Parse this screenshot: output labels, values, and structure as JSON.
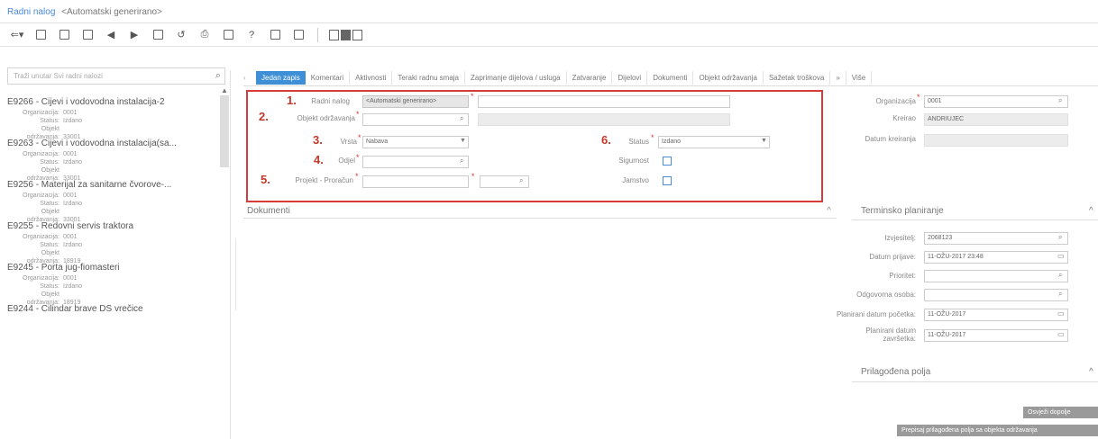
{
  "header": {
    "title": "Radni nalog",
    "subtitle": "<Automatski generirano>"
  },
  "toolbar": {
    "icons": [
      "back-dropdown-icon",
      "save-icon",
      "save-copy-icon",
      "delete-icon",
      "prev-icon",
      "next-icon",
      "copy-icon",
      "undo-icon",
      "print-icon",
      "preview-icon",
      "help-icon",
      "comment-icon",
      "attach-icon",
      "layout-icons"
    ]
  },
  "sidebar": {
    "search_placeholder": "Traži unutar Svi radni nalozi",
    "field_labels": {
      "org": "Organizacija:",
      "status": "Status:",
      "object": "Objekt održavanja:"
    },
    "items": [
      {
        "title": "E9266 - Cijevi i vodovodna instalacija-2",
        "org": "0001",
        "status": "Izdano",
        "object": "33001"
      },
      {
        "title": "E9263 - Cijevi i vodovodna instalacija(sa...",
        "org": "0001",
        "status": "Izdano",
        "object": "33001"
      },
      {
        "title": "E9256 - Materijal za sanitarne čvorove-...",
        "org": "0001",
        "status": "Izdano",
        "object": "33001"
      },
      {
        "title": "E9255 - Redovni servis traktora",
        "org": "0001",
        "status": "Izdano",
        "object": "18919"
      },
      {
        "title": "E9245 - Porta jug-fiomasteri",
        "org": "0001",
        "status": "Izdano",
        "object": "18919"
      },
      {
        "title": "E9244 - Cilindar brave DS vrečice",
        "org": "",
        "status": "",
        "object": ""
      }
    ]
  },
  "tabs": [
    "Jedan zapis",
    "Komentari",
    "Aktivnosti",
    "Teraki radnu smaja",
    "Zaprimanje dijelova / usluga",
    "Zatvaranje",
    "Dijelovi",
    "Dokumenti",
    "Objekt održavanja",
    "Sažetak troškova",
    "Više"
  ],
  "form": {
    "markers": [
      "1.",
      "2.",
      "3.",
      "4.",
      "5.",
      "6."
    ],
    "labels": {
      "radni_nalog": "Radni nalog",
      "objekt": "Objekt održavanja",
      "vrsta": "Vrsta",
      "odjel": "Odjel",
      "projekt": "Projekt - Proračun",
      "status": "Status",
      "sigurnost": "Sigurnost",
      "jamstvo": "Jamstvo"
    },
    "values": {
      "radni_nalog": "<Automatski generirano>",
      "vrsta": "Nabava",
      "status": "Izdano"
    },
    "right": {
      "organizacija_label": "Organizacija",
      "organizacija_value": "0001",
      "kreirao_label": "Kreirao",
      "kreirao_value": "ANDRIUJEC",
      "datum_kreiranja_label": "Datum kreiranja"
    }
  },
  "documents": {
    "title": "Dokumenti"
  },
  "planning": {
    "title": "Terminsko planiranje",
    "fields": [
      {
        "label": "Izvjesitelj:",
        "value": "2068123"
      },
      {
        "label": "Datum prijave:",
        "value": "11-OŽU-2017 23:48"
      },
      {
        "label": "Prioritet:",
        "value": ""
      },
      {
        "label": "Odgovorna osoba:",
        "value": ""
      },
      {
        "label": "Planirani datum početka:",
        "value": "11-OŽU-2017"
      },
      {
        "label": "Planirani datum završetka:",
        "value": "11-OŽU-2017"
      }
    ]
  },
  "custom": {
    "title": "Prilagođena polja",
    "btn1": "Osvježi dopolje",
    "btn2": "Prepisaj prilagođena polja sa objekta održavanja"
  }
}
